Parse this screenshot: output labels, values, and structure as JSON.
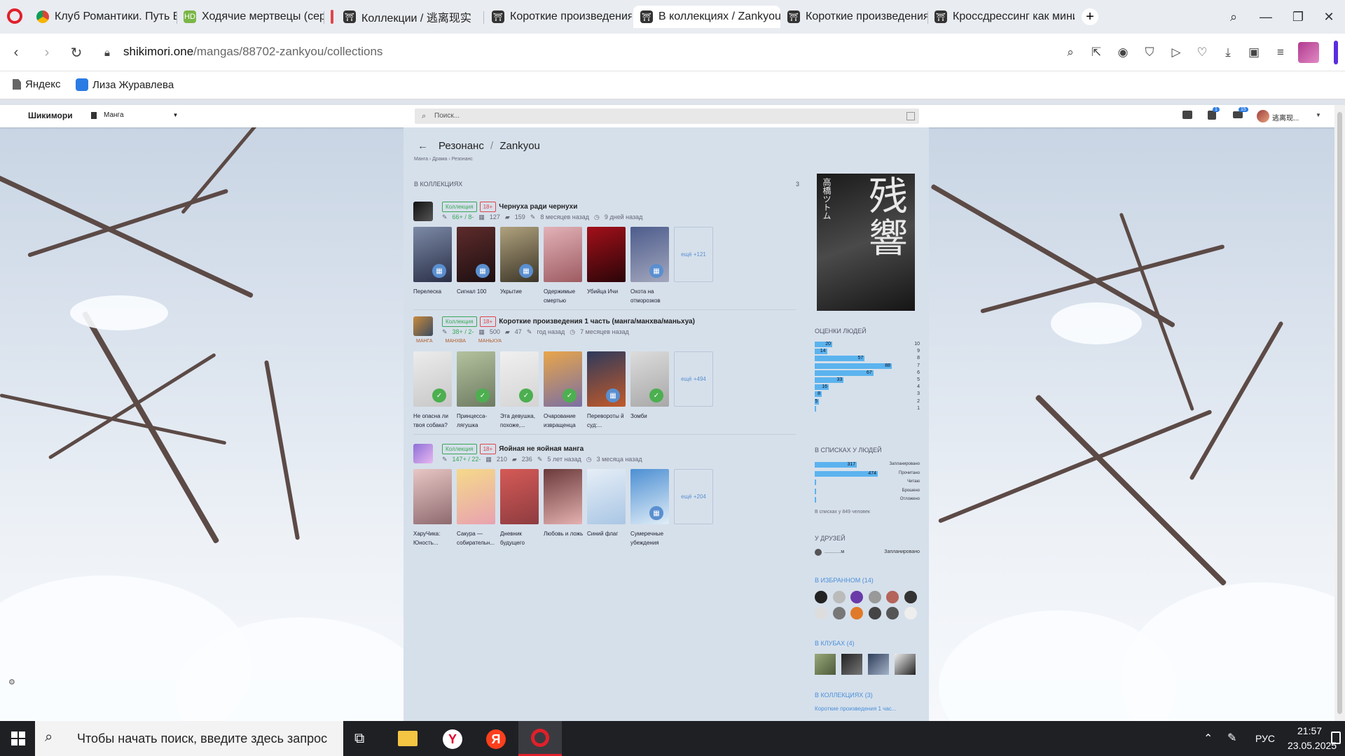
{
  "browser": {
    "tabs": [
      {
        "label": "Клуб Романтики. Путь Ва",
        "active": false
      },
      {
        "label": "Ходячие мертвецы (сери",
        "active": false
      },
      {
        "label": "Коллекции / 逃离现实",
        "active": false
      },
      {
        "label": "Короткие произведения",
        "active": false
      },
      {
        "label": "В коллекциях / Zankyou",
        "active": true
      },
      {
        "label": "Короткие произведения",
        "active": false
      },
      {
        "label": "Кроссдрессинг как мини",
        "active": false
      }
    ],
    "url_host": "shikimori.one",
    "url_path": "/mangas/88702-zankyou/collections",
    "bookmarks": [
      {
        "label": "Яндекс"
      },
      {
        "label": "Лиза Журавлева"
      }
    ]
  },
  "site": {
    "brand": "Шикимори",
    "section": "Манга",
    "search_placeholder": "Поиск...",
    "user_name": "逃离现...",
    "badge_1": "1",
    "badge_2": "15"
  },
  "page": {
    "title_ru": "Резонанс",
    "title_sep": "/",
    "title_en": "Zankyou",
    "breadcrumb": "Манга › Драма › Резонанс",
    "section_label": "В КОЛЛЕКЦИЯХ",
    "section_count": "3"
  },
  "collections": [
    {
      "tag": "Коллекция",
      "age": "18+",
      "title": "Чернуха ради чернухи",
      "votes": "66+ / 8-",
      "items": "127",
      "comments": "159",
      "created": "8 месяцев назад",
      "updated": "9 дней назад",
      "kinds": [],
      "more": "ещё +121",
      "entries": [
        {
          "title": "Перелеска"
        },
        {
          "title": "Сигнал 100"
        },
        {
          "title": "Укрытие"
        },
        {
          "title": "Одержимые смертью"
        },
        {
          "title": "Убийца Ичи"
        },
        {
          "title": "Охота на отморозков"
        }
      ]
    },
    {
      "tag": "Коллекция",
      "age": "18+",
      "title": "Короткие произведения 1 часть (манга/манхва/маньхуа)",
      "votes": "38+ / 2-",
      "items": "500",
      "comments": "47",
      "created": "год назад",
      "updated": "7 месяцев назад",
      "kinds": [
        "МАНГА",
        "МАНХВА",
        "МАНЬХУА"
      ],
      "more": "ещё +494",
      "entries": [
        {
          "title": "Не опасна ли твоя собака?"
        },
        {
          "title": "Принцесса-лягушка"
        },
        {
          "title": "Эта девушка, похоже,..."
        },
        {
          "title": "Очарование извращенца"
        },
        {
          "title": "Перевороты й суд:..."
        },
        {
          "title": "Зомби"
        }
      ]
    },
    {
      "tag": "Коллекция",
      "age": "18+",
      "title": "Яойная не яойная манга",
      "votes": "147+ / 22-",
      "items": "210",
      "comments": "236",
      "created": "5 лет назад",
      "updated": "3 месяца назад",
      "kinds": [],
      "more": "ещё +204",
      "entries": [
        {
          "title": "ХаруЧика: Юность..."
        },
        {
          "title": "Сакура — собирательн..."
        },
        {
          "title": "Дневник будущего"
        },
        {
          "title": "Любовь и ложь"
        },
        {
          "title": "Синий флаг"
        },
        {
          "title": "Сумеречные убеждения"
        }
      ]
    }
  ],
  "sidebar": {
    "poster_text": "残響",
    "poster_author": "高橋ツトム",
    "scores_label": "ОЦЕНКИ ЛЮДЕЙ",
    "scores": [
      {
        "score": "10",
        "count": "20"
      },
      {
        "score": "9",
        "count": "14"
      },
      {
        "score": "8",
        "count": "57"
      },
      {
        "score": "7",
        "count": "88"
      },
      {
        "score": "6",
        "count": "67"
      },
      {
        "score": "5",
        "count": "33"
      },
      {
        "score": "4",
        "count": "16"
      },
      {
        "score": "3",
        "count": "8"
      },
      {
        "score": "2",
        "count": "5"
      },
      {
        "score": "1",
        "count": ""
      }
    ],
    "lists_label": "В СПИСКАХ У ЛЮДЕЙ",
    "lists": [
      {
        "label": "Запланировано",
        "count": "317"
      },
      {
        "label": "Прочитано",
        "count": "474"
      },
      {
        "label": "Читаю",
        "count": ""
      },
      {
        "label": "Брошено",
        "count": ""
      },
      {
        "label": "Отложено",
        "count": ""
      }
    ],
    "lists_total": "В списках у 849 человек",
    "friends_label": "У ДРУЗЕЙ",
    "friend_name": "............м",
    "friend_status": "Запланировано",
    "favorites_label": "В ИЗБРАННОМ (14)",
    "clubs_label": "В КЛУБАХ (4)",
    "collections_label": "В КОЛЛЕКЦИЯХ (3)",
    "collection_link": "Короткие произведения 1 час..."
  },
  "taskbar": {
    "search_placeholder": "Чтобы начать поиск, введите здесь запрос",
    "lang": "РУС",
    "time": "21:57",
    "date": "23.05.2025"
  },
  "colors": {
    "accent": "#5bb3ee",
    "link": "#4a90d9",
    "pill_green": "#3aa757",
    "pill_red": "#e0464b",
    "check_green": "#4caf50",
    "plan_blue": "#5a8fd0"
  }
}
